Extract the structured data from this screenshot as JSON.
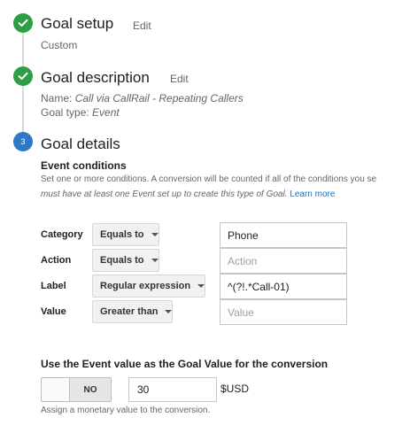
{
  "steps": [
    {
      "title": "Goal setup",
      "edit_label": "Edit",
      "subtitle": "Custom",
      "status": "complete"
    },
    {
      "title": "Goal description",
      "edit_label": "Edit",
      "name_label": "Name:",
      "name_value": "Call via CallRail - Repeating Callers",
      "type_label": "Goal type:",
      "type_value": "Event",
      "status": "complete"
    },
    {
      "number": "3",
      "title": "Goal details",
      "status": "current"
    }
  ],
  "event_conditions": {
    "heading": "Event conditions",
    "description_line1": "Set one or more conditions. A conversion will be counted if all of the conditions you se",
    "description_line2": "must have at least one Event set up to create this type of Goal.",
    "learn_more": "Learn more",
    "rows": [
      {
        "label": "Category",
        "operator": "Equals to",
        "value": "Phone",
        "placeholder": ""
      },
      {
        "label": "Action",
        "operator": "Equals to",
        "value": "",
        "placeholder": "Action"
      },
      {
        "label": "Label",
        "operator": "Regular expression",
        "value": "^(?!.*Call-01)",
        "placeholder": ""
      },
      {
        "label": "Value",
        "operator": "Greater than",
        "value": "",
        "placeholder": "Value"
      }
    ]
  },
  "goal_value": {
    "heading": "Use the Event value as the Goal Value for the conversion",
    "toggle_label": "NO",
    "amount": "30",
    "currency": "$USD",
    "help": "Assign a monetary value to the conversion."
  },
  "colors": {
    "complete": "#2e9e44",
    "current": "#2d79c7",
    "link": "#1a73c8"
  },
  "icons": {
    "complete": "check-circle-icon",
    "caret": "caret-down-icon"
  }
}
